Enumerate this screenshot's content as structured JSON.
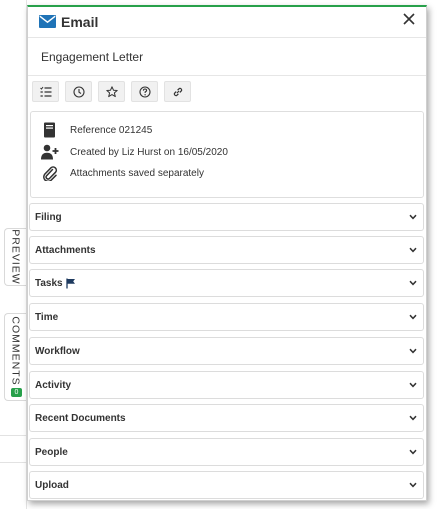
{
  "side_tabs": {
    "preview": "PREVIEW",
    "comments": "COMMENTS",
    "comments_badge": "0"
  },
  "header": {
    "title": "Email",
    "icon": "envelope-icon",
    "accent_color": "#27a04a",
    "icon_color": "#1f73b7"
  },
  "subject": "Engagement Letter",
  "toolbar": [
    {
      "icon": "checklist-icon"
    },
    {
      "icon": "clock-icon"
    },
    {
      "icon": "star-icon"
    },
    {
      "icon": "help-icon"
    },
    {
      "icon": "link-icon"
    }
  ],
  "meta": {
    "reference": "Reference 021245",
    "created": "Created by Liz Hurst on 16/05/2020",
    "attachments": "Attachments saved separately"
  },
  "sections": [
    {
      "label": "Filing"
    },
    {
      "label": "Attachments"
    },
    {
      "label": "Tasks",
      "flag_icon": "flag-icon"
    },
    {
      "label": "Time"
    },
    {
      "label": "Workflow"
    },
    {
      "label": "Activity"
    },
    {
      "label": "Recent Documents"
    },
    {
      "label": "People"
    },
    {
      "label": "Upload"
    }
  ]
}
